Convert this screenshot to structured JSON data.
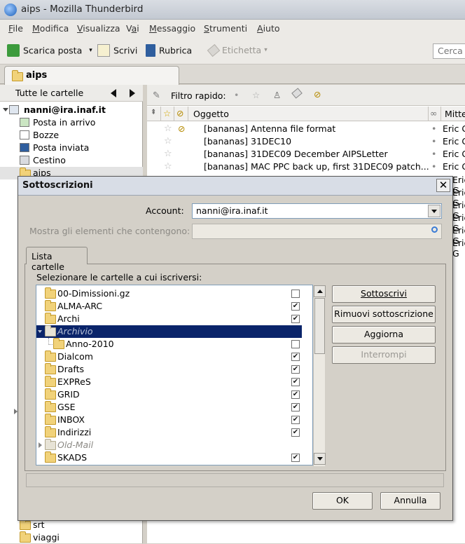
{
  "window": {
    "title": "aips - Mozilla Thunderbird"
  },
  "menubar": {
    "items": [
      {
        "pre": "",
        "ul": "F",
        "post": "ile"
      },
      {
        "pre": "",
        "ul": "M",
        "post": "odifica"
      },
      {
        "pre": "",
        "ul": "V",
        "post": "isualizza"
      },
      {
        "pre": "V",
        "ul": "a",
        "post": "i"
      },
      {
        "pre": "",
        "ul": "M",
        "post": "essaggio"
      },
      {
        "pre": "",
        "ul": "S",
        "post": "trumenti"
      },
      {
        "pre": "",
        "ul": "A",
        "post": "iuto"
      }
    ]
  },
  "toolbar": {
    "get_mail": "Scarica posta",
    "write": "Scrivi",
    "address_book": "Rubrica",
    "tag": "Etichetta",
    "search_placeholder": "Cerca"
  },
  "tabs": {
    "active": "aips"
  },
  "leftpane": {
    "header": "Tutte le cartelle",
    "account": "nanni@ira.inaf.it",
    "folders": [
      "Posta in arrivo",
      "Bozze",
      "Posta inviata",
      "Cestino",
      "aips"
    ],
    "bottom_folders": [
      "srt",
      "viaggi"
    ]
  },
  "quickfilter": {
    "label": "Filtro rapido:"
  },
  "messagelist": {
    "columns": {
      "subject": "Oggetto",
      "sender": "Mitte"
    },
    "rows": [
      {
        "subject": "[bananas] Antenna file format",
        "sender": "Eric G"
      },
      {
        "subject": "[bananas] 31DEC10",
        "sender": "Eric G"
      },
      {
        "subject": "[bananas] 31DEC09 December AIPSLetter",
        "sender": "Eric G"
      },
      {
        "subject": "[bananas] MAC PPC back up, first 31DEC09 patch...",
        "sender": "Eric G"
      }
    ],
    "extra_senders": [
      "Eric G",
      "Eric G",
      "Eric G",
      "Eric G",
      "Eric G",
      "Eric G"
    ]
  },
  "dialog": {
    "title": "Sottoscrizioni",
    "close": "✕",
    "account_label": "Account:",
    "account_value": "nanni@ira.inaf.it",
    "filter_label": "Mostra gli elementi che contengono:",
    "tab_label": "Lista cartelle",
    "list_caption": "Selezionare le cartelle a cui iscriversi:",
    "folders": [
      {
        "name": "00-Dimissioni.gz",
        "checked": false
      },
      {
        "name": "ALMA-ARC",
        "checked": true
      },
      {
        "name": "Archi",
        "checked": true
      },
      {
        "name": "Archivio",
        "selected": true
      },
      {
        "name": "Anno-2010",
        "checked": false,
        "indent": true
      },
      {
        "name": "Dialcom",
        "checked": true
      },
      {
        "name": "Drafts",
        "checked": true
      },
      {
        "name": "EXPReS",
        "checked": true
      },
      {
        "name": "GRID",
        "checked": true
      },
      {
        "name": "GSE",
        "checked": true
      },
      {
        "name": "INBOX",
        "checked": true
      },
      {
        "name": "Indirizzi",
        "checked": true
      },
      {
        "name": "Old-Mail",
        "italic": true
      },
      {
        "name": "SKADS",
        "checked": true
      }
    ],
    "buttons": {
      "subscribe": "Sottoscrivi",
      "unsubscribe": "Rimuovi sottoscrizione",
      "refresh": "Aggiorna",
      "stop": "Interrompi",
      "ok": "OK",
      "cancel": "Annulla"
    }
  },
  "colors": {
    "selection": "#0a246a",
    "dialog_bg": "#d4d0c8"
  }
}
